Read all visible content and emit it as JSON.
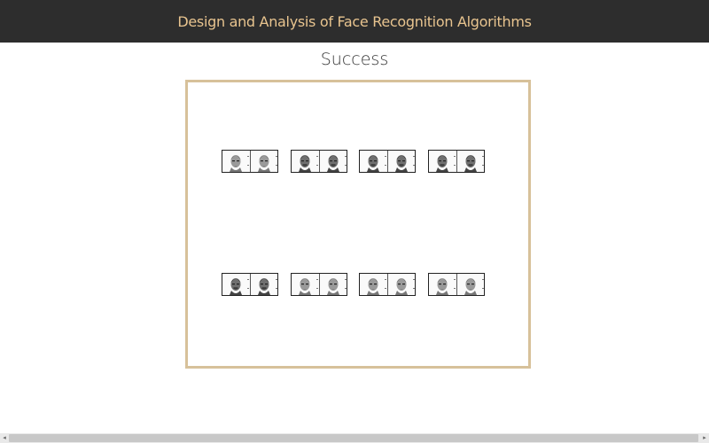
{
  "header": {
    "title": "Design and Analysis of Face Recognition Algorithms"
  },
  "main": {
    "heading": "Success"
  },
  "gallery": {
    "rows": [
      [
        {
          "left": "light",
          "right": "light"
        },
        {
          "left": "dark",
          "right": "dark"
        },
        {
          "left": "dark",
          "right": "dark"
        },
        {
          "left": "dark",
          "right": "dark"
        }
      ],
      [
        {
          "left": "dark",
          "right": "dark"
        },
        {
          "left": "light",
          "right": "light"
        },
        {
          "left": "light",
          "right": "light"
        },
        {
          "left": "light",
          "right": "light"
        }
      ]
    ]
  },
  "scrollbar": {
    "left_arrow": "◂",
    "right_arrow": "▸"
  }
}
